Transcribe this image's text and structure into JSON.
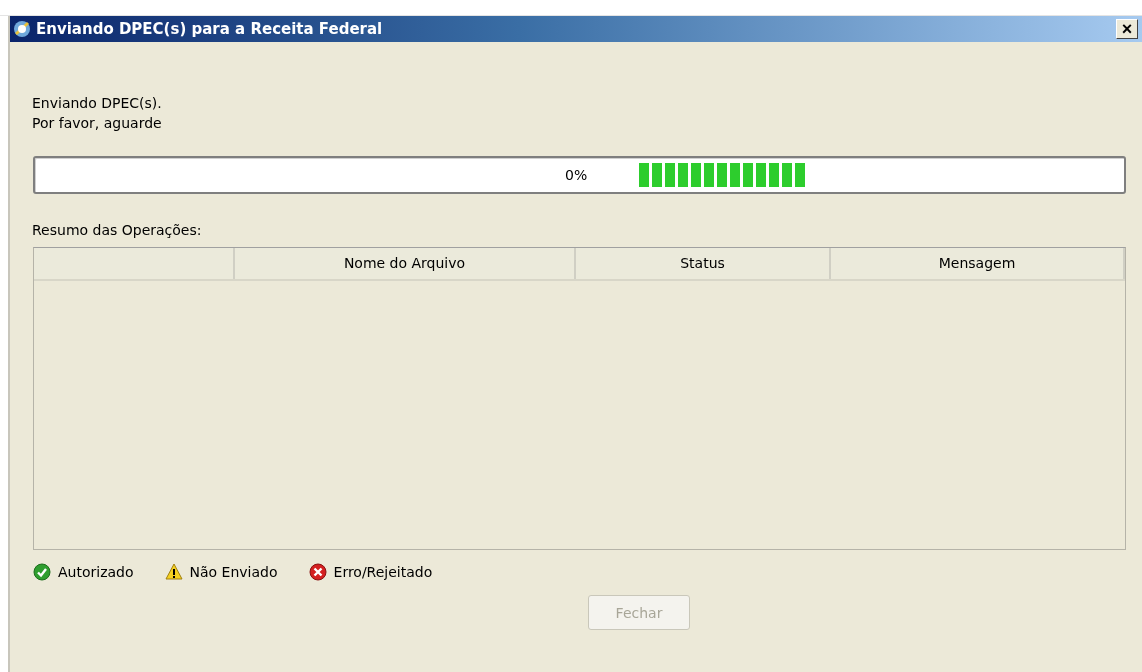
{
  "window": {
    "title": "Enviando DPEC(s) para a Receita Federal",
    "close": "×"
  },
  "message": [
    "Enviando DPEC(s).",
    "Por favor, aguarde"
  ],
  "progress": {
    "reading": "0%",
    "indeterminate": true
  },
  "summary_label": "Resumo das Operações:",
  "table": {
    "columns": [
      "Nome do Arquivo",
      "Status",
      "Mensagem"
    ]
  },
  "legend": [
    {
      "kind": "ok",
      "label": "Autorizado"
    },
    {
      "kind": "warning",
      "label": "Não Enviado"
    },
    {
      "kind": "error",
      "label": "Erro/Rejeitado"
    }
  ],
  "buttons": [
    {
      "label": "Fechar",
      "disabled": true
    }
  ]
}
